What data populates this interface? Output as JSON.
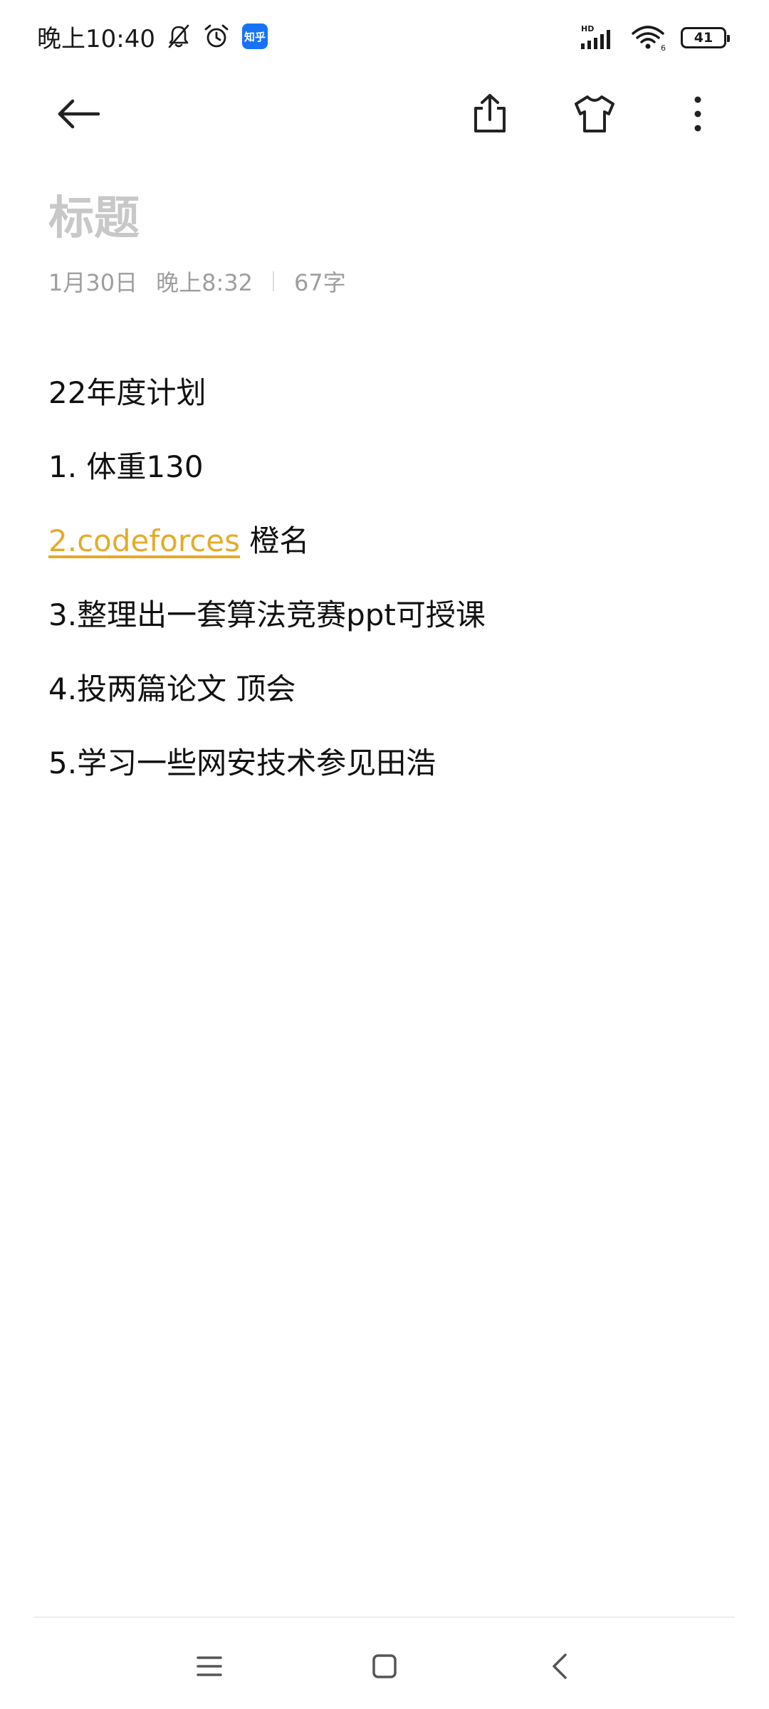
{
  "status_bar": {
    "time": "晚上10:40",
    "app_badge": "知乎",
    "network_label": "HD",
    "wifi_label": "6",
    "battery_level": "41"
  },
  "toolbar": {
    "back_icon": "back-arrow-icon",
    "share_icon": "share-icon",
    "theme_icon": "shirt-icon",
    "more_icon": "more-vertical-icon"
  },
  "note": {
    "title_placeholder": "标题",
    "date": "1月30日",
    "time": "晚上8:32",
    "char_count": "67字",
    "lines": [
      {
        "text": "22年度计划"
      },
      {
        "text": "1. 体重130"
      },
      {
        "link": "2.codeforces",
        "text": " 橙名"
      },
      {
        "text": "3.整理出一套算法竞赛ppt可授课"
      },
      {
        "text": "4.投两篇论文 顶会"
      },
      {
        "text": "5.学习一些网安技术参见田浩"
      }
    ]
  },
  "nav_bar": {
    "menu_icon": "menu-icon",
    "home_icon": "home-icon",
    "back_icon": "nav-back-icon"
  },
  "colors": {
    "link": "#e4ab2a",
    "title_placeholder": "#c8c8c8",
    "meta": "#9e9e9e",
    "zhihu_blue": "#1772f6"
  }
}
